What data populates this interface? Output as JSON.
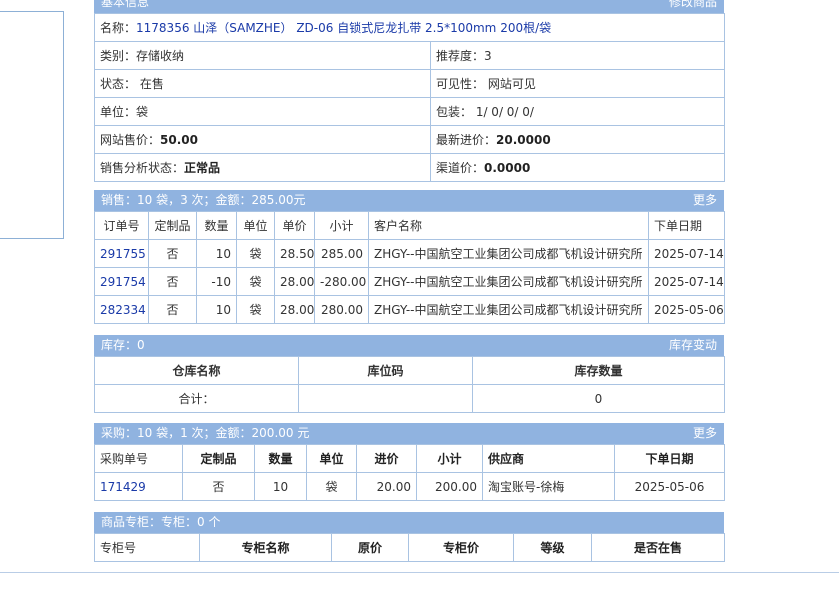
{
  "basic": {
    "header_title": "基本信息",
    "header_action": "修改商品",
    "name_label": "名称：",
    "name_value": "1178356 山泽（SAMZHE） ZD-06 自锁式尼龙扎带 2.5*100mm 200根/袋",
    "category": "类别：存储收纳",
    "recommend": "推荐度：3",
    "status": "状态： 在售",
    "visibility": "可见性： 网站可见",
    "unit": "单位：袋",
    "package": "包装： 1/ 0/ 0/ 0/",
    "site_price_label": "网站售价：",
    "site_price_value": "50.00",
    "latest_cost_label": "最新进价：",
    "latest_cost_value": "20.0000",
    "sales_status_label": "销售分析状态：",
    "sales_status_value": "正常品",
    "channel_price_label": "渠道价：",
    "channel_price_value": "0.0000"
  },
  "sales": {
    "header_title": "销售：10 袋，3 次；金额：285.00元",
    "header_action": "更多",
    "columns": [
      "订单号",
      "定制品",
      "数量",
      "单位",
      "单价",
      "小计",
      "客户名称",
      "下单日期"
    ],
    "rows": [
      {
        "order": "291755",
        "custom": "否",
        "qty": "10",
        "unit": "袋",
        "price": "28.50",
        "subtotal": "285.00",
        "customer": "ZHGY--中国航空工业集团公司成都飞机设计研究所",
        "date": "2025-07-14"
      },
      {
        "order": "291754",
        "custom": "否",
        "qty": "-10",
        "unit": "袋",
        "price": "28.00",
        "subtotal": "-280.00",
        "customer": "ZHGY--中国航空工业集团公司成都飞机设计研究所",
        "date": "2025-07-14"
      },
      {
        "order": "282334",
        "custom": "否",
        "qty": "10",
        "unit": "袋",
        "price": "28.00",
        "subtotal": "280.00",
        "customer": "ZHGY--中国航空工业集团公司成都飞机设计研究所",
        "date": "2025-05-06"
      }
    ]
  },
  "stock": {
    "header_title": "库存：0",
    "header_action": "库存变动",
    "columns": [
      "仓库名称",
      "库位码",
      "库存数量"
    ],
    "total_label": "合计：",
    "total_value": "0"
  },
  "purchase": {
    "header_title": "采购：10 袋，1 次；金额：200.00 元",
    "header_action": "更多",
    "columns": [
      "采购单号",
      "定制品",
      "数量",
      "单位",
      "进价",
      "小计",
      "供应商",
      "下单日期"
    ],
    "rows": [
      {
        "order": "171429",
        "custom": "否",
        "qty": "10",
        "unit": "袋",
        "price": "20.00",
        "subtotal": "200.00",
        "supplier": "淘宝账号-徐梅",
        "date": "2025-05-06"
      }
    ]
  },
  "counter": {
    "header_title": "商品专柜：专柜：0 个",
    "columns": [
      "专柜号",
      "专柜名称",
      "原价",
      "专柜价",
      "等级",
      "是否在售"
    ]
  }
}
